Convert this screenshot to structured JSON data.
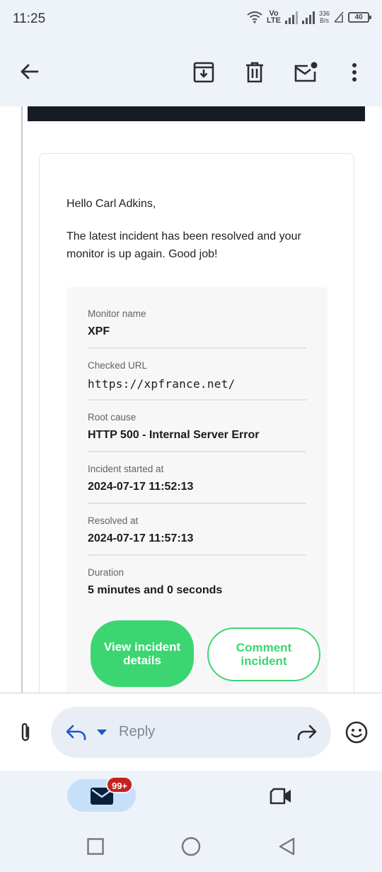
{
  "status_bar": {
    "time": "11:25",
    "volte_top": "Vo",
    "volte_bottom": "LTE",
    "speed_value": "336",
    "speed_unit": "B/s",
    "battery": "40"
  },
  "toolbar": {
    "back_icon": "arrow-left-icon",
    "archive_icon": "archive-icon",
    "delete_icon": "trash-icon",
    "mark_unread_icon": "mail-unread-icon",
    "more_icon": "more-vert-icon"
  },
  "email": {
    "greeting": "Hello Carl Adkins,",
    "intro": "The latest incident has been resolved and your monitor is up again. Good job!",
    "details": [
      {
        "label": "Monitor name",
        "value": "XPF"
      },
      {
        "label": "Checked URL",
        "value": "https://xpfrance.net/"
      },
      {
        "label": "Root cause",
        "value": "HTTP 500 - Internal Server Error"
      },
      {
        "label": "Incident started at",
        "value": "2024-07-17 11:52:13"
      },
      {
        "label": "Resolved at",
        "value": "2024-07-17 11:57:13"
      },
      {
        "label": "Duration",
        "value": "5 minutes and 0 seconds"
      }
    ],
    "view_button": "View incident details",
    "comment_button": "Comment incident",
    "accent_color": "#3bd671"
  },
  "reply_bar": {
    "placeholder": "Reply",
    "attach_icon": "paperclip-icon",
    "reply_icon": "reply-icon",
    "dropdown_icon": "caret-down-icon",
    "forward_icon": "forward-icon",
    "emoji_icon": "emoji-icon"
  },
  "bottom_nav": {
    "mail_badge": "99+",
    "mail_icon": "mail-icon",
    "meet_icon": "video-camera-icon"
  },
  "system_nav": {
    "recents_icon": "square-icon",
    "home_icon": "circle-icon",
    "back_icon": "triangle-back-icon"
  }
}
